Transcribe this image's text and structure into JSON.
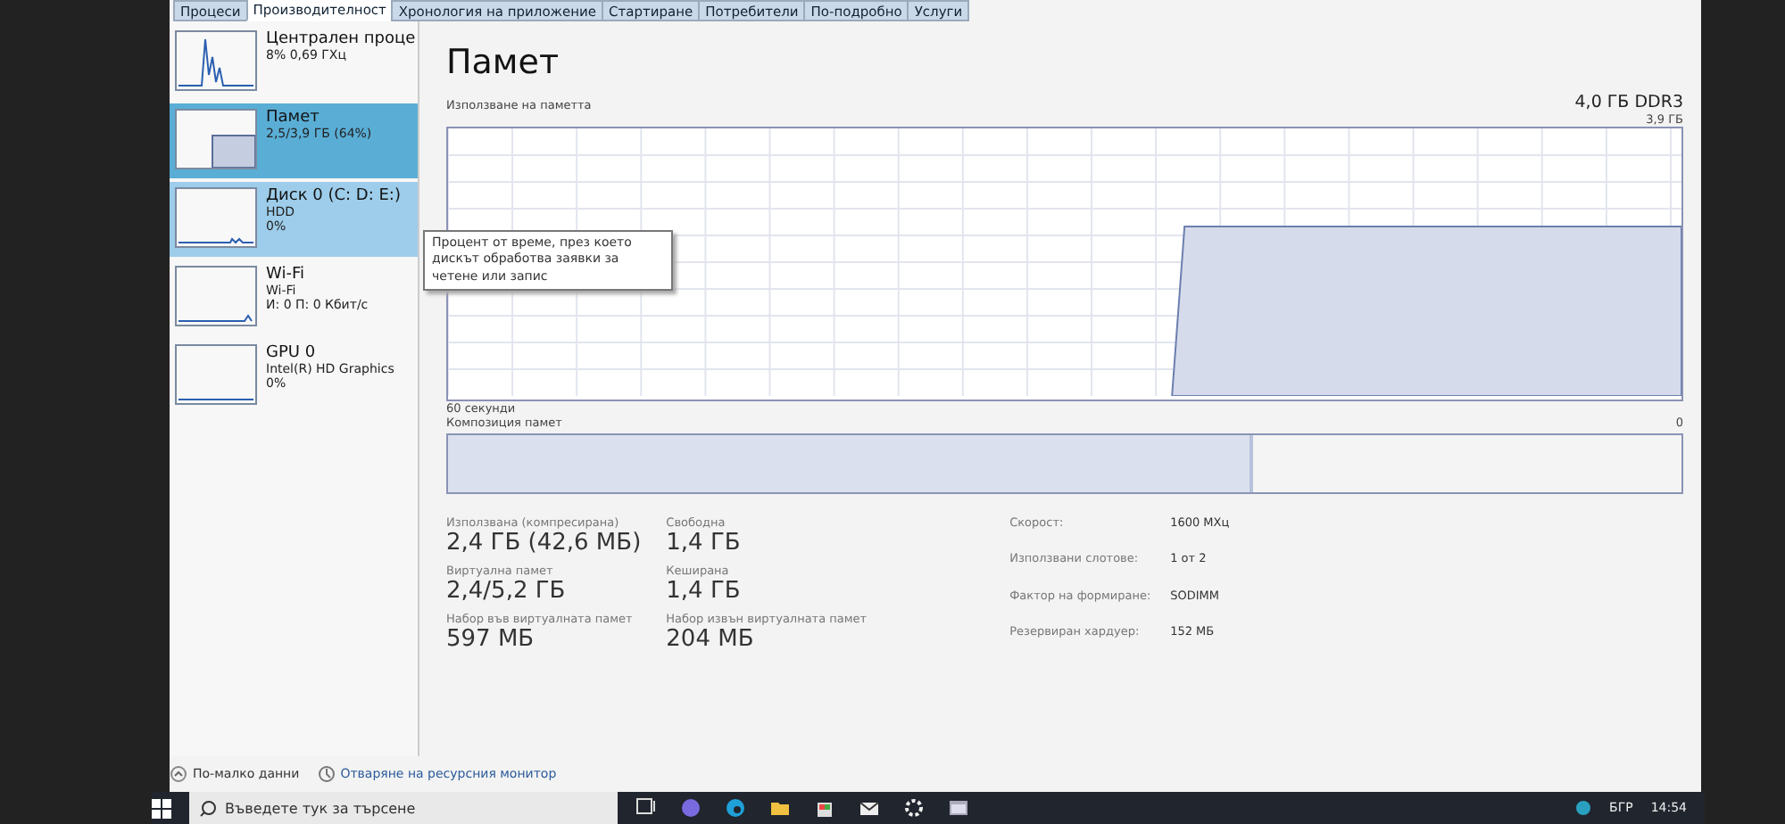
{
  "tabs": [
    {
      "label": "Процеси",
      "selected": false
    },
    {
      "label": "Производителност",
      "selected": true
    },
    {
      "label": "Хронология на приложение",
      "selected": false
    },
    {
      "label": "Стартиране",
      "selected": false
    },
    {
      "label": "Потребители",
      "selected": false
    },
    {
      "label": "По-подробно",
      "selected": false
    },
    {
      "label": "Услуги",
      "selected": false
    }
  ],
  "sidebar": {
    "items": [
      {
        "name": "Централен проце",
        "detail_1": "8% 0,69 ГХц",
        "selected": false,
        "hovered": false
      },
      {
        "name": "Памет",
        "detail_1": "2,5/3,9 ГБ (64%)",
        "selected": true,
        "hovered": false
      },
      {
        "name": "Диск 0 (C: D: E:)",
        "detail_1": "HDD",
        "detail_2": "0%",
        "selected": false,
        "hovered": true
      },
      {
        "name": "Wi-Fi",
        "detail_1": "Wi-Fi",
        "detail_2": "И: 0 П: 0 Кбит/с",
        "selected": false,
        "hovered": false
      },
      {
        "name": "GPU 0",
        "detail_1": "Intel(R) HD Graphics",
        "detail_2": "0%",
        "selected": false,
        "hovered": false
      }
    ]
  },
  "tooltip": "Процент от време, през което дискът обработва заявки за четене или запис",
  "main": {
    "title": "Памет",
    "chart_label": "Използване на паметта",
    "capacity": "4,0 ГБ DDR3",
    "max_label": "3,9 ГБ",
    "time_label": "60 секунди",
    "zero_label": "0",
    "composition_label": "Композиция памет",
    "composition": {
      "level": 0.65
    },
    "stats": [
      {
        "label": "Използвана (компресирана)",
        "value": "2,4 ГБ (42,6 МБ)"
      },
      {
        "label": "Свободна",
        "value": "1,4 ГБ"
      },
      {
        "label": "Виртуална памет",
        "value": "2,4/5,2 ГБ"
      },
      {
        "label": "Кеширана",
        "value": "1,4 ГБ"
      },
      {
        "label": "Набор във виртуалната памет",
        "value": "597 МБ"
      },
      {
        "label": "Набор извън виртуалната памет",
        "value": "204 МБ"
      }
    ],
    "properties": [
      {
        "label": "Скорост:",
        "value": "1600 МХц"
      },
      {
        "label": "Използвани слотове:",
        "value": "1 от 2"
      },
      {
        "label": "Фактор на формиране:",
        "value": "SODIMM"
      },
      {
        "label": "Резервиран хардуер:",
        "value": "152 МБ"
      }
    ]
  },
  "footer": {
    "less_details": "По-малко данни",
    "resource_monitor": "Отваряне на ресурсния монитор"
  },
  "taskbar": {
    "search_placeholder": "Въведете тук за търсене",
    "language": "БГР",
    "time": "14:54"
  }
}
